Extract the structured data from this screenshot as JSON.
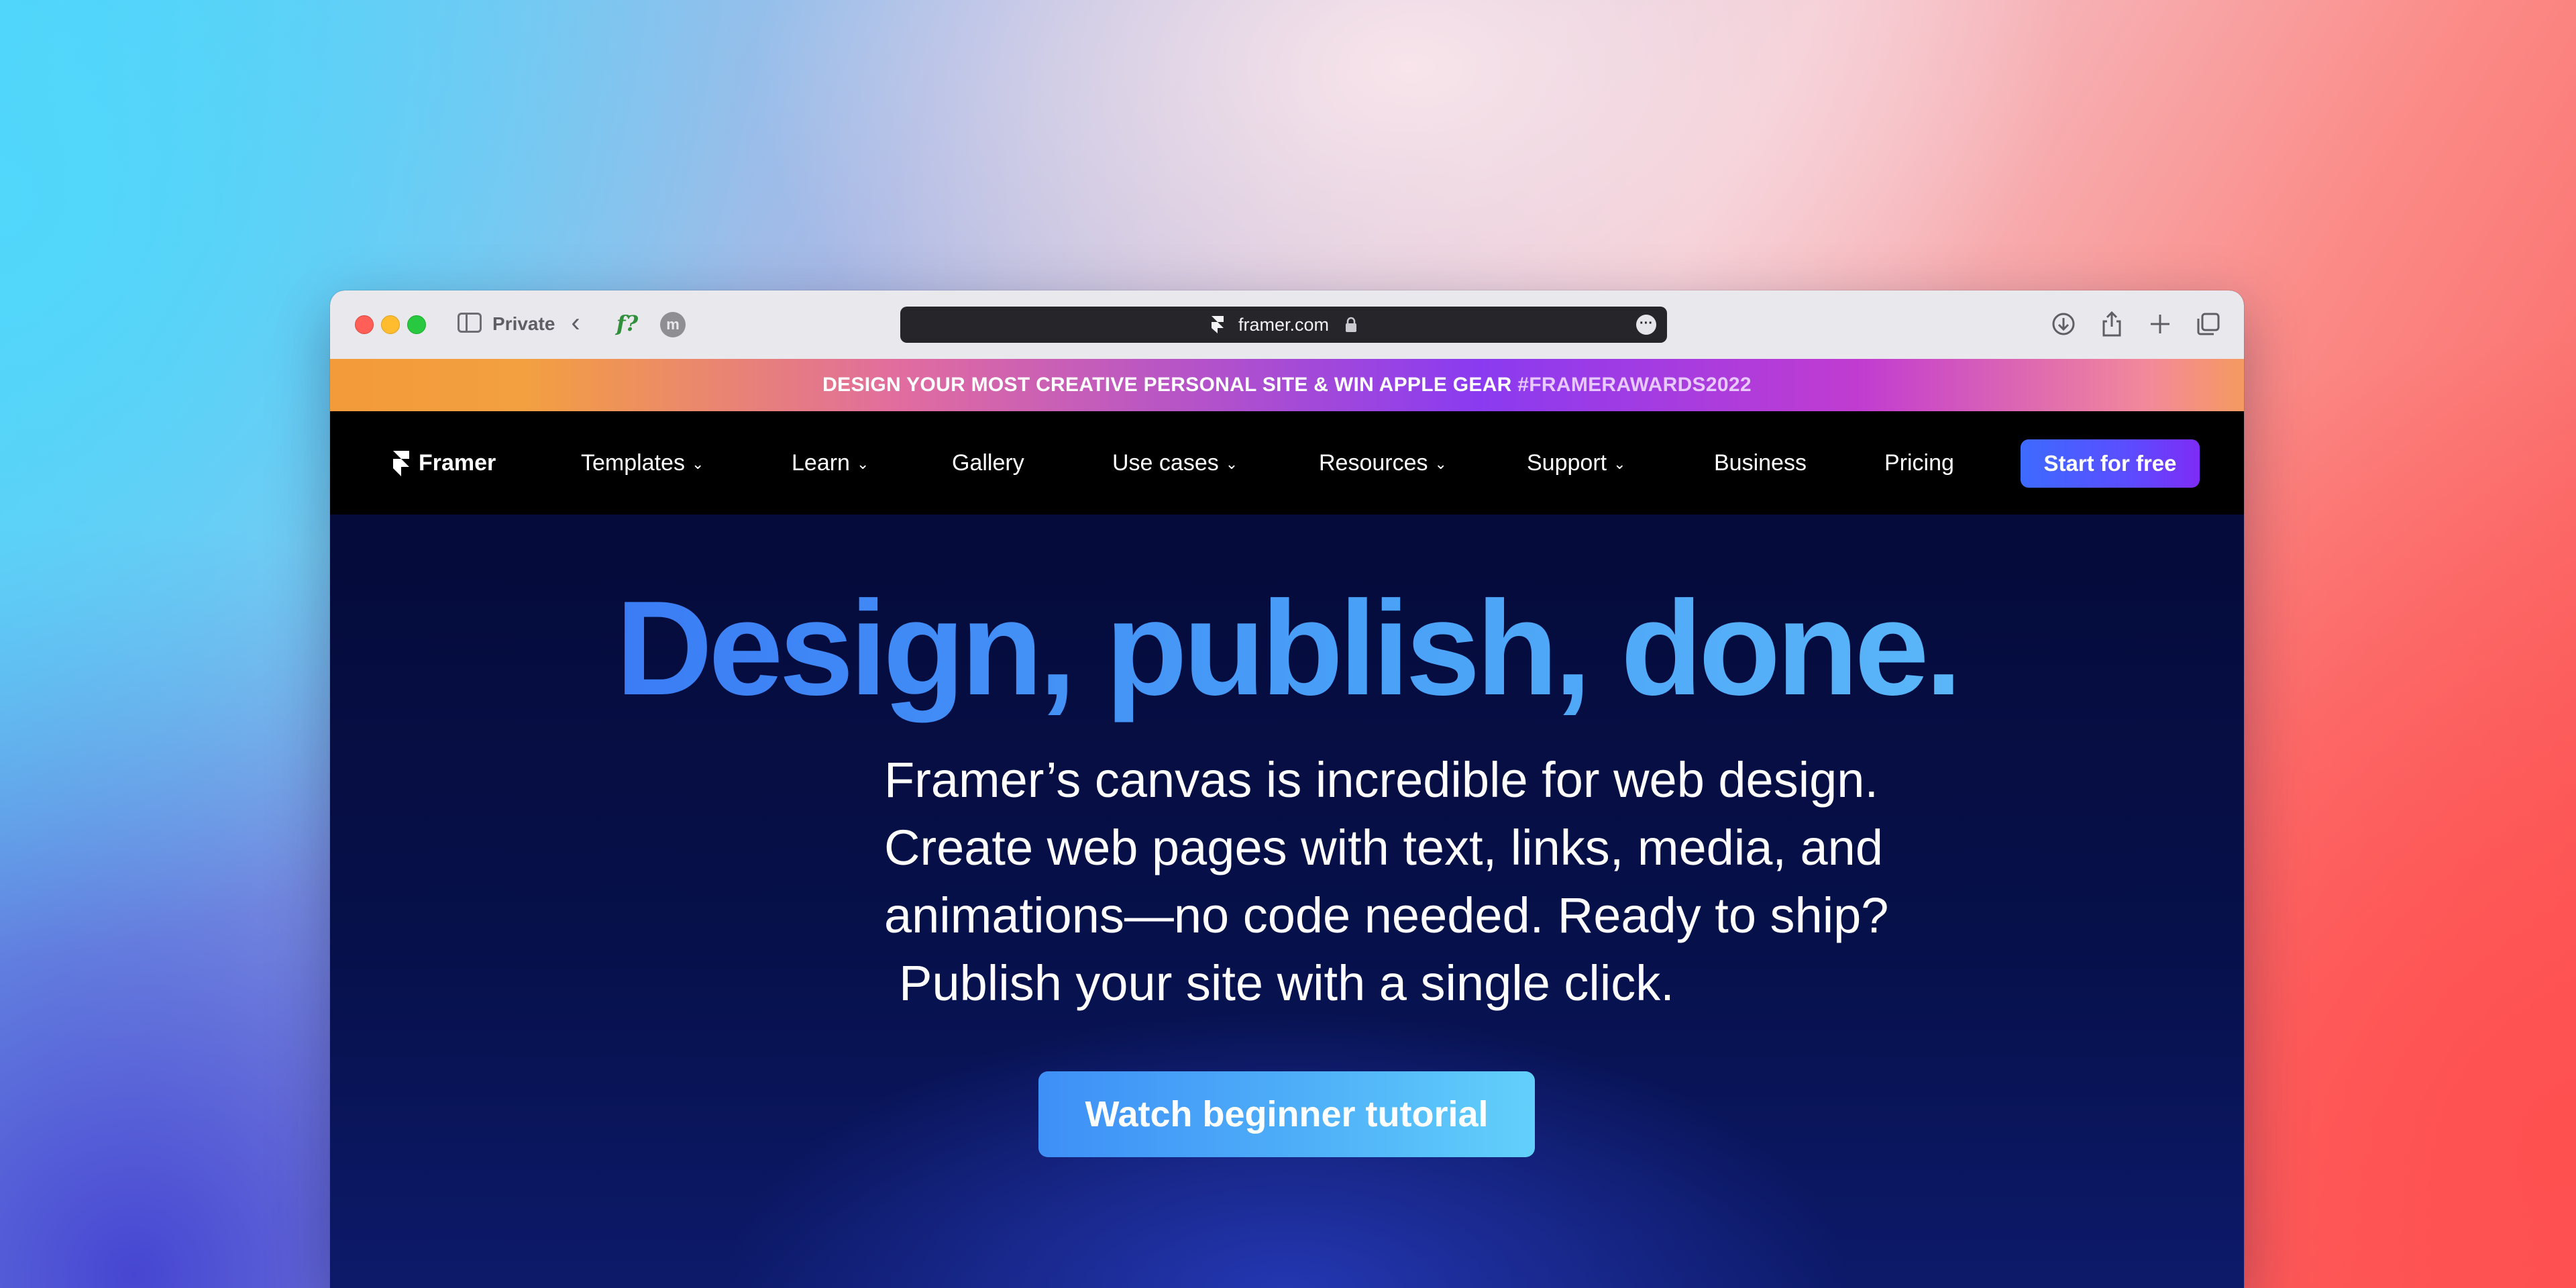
{
  "browser": {
    "private_label": "Private",
    "url": "framer.com",
    "extension_1": "f?",
    "extension_2": "m",
    "icons": [
      "sidebar-icon",
      "back-icon",
      "lock-icon",
      "more-icon",
      "download-icon",
      "share-icon",
      "new-tab-icon",
      "tabs-overview-icon"
    ]
  },
  "promo": {
    "text": "DESIGN YOUR MOST CREATIVE PERSONAL SITE & WIN APPLE GEAR",
    "hashtag": "#FRAMERAWARDS2022"
  },
  "nav": {
    "brand": "Framer",
    "items": [
      {
        "label": "Templates",
        "dropdown": true
      },
      {
        "label": "Learn",
        "dropdown": true
      },
      {
        "label": "Gallery",
        "dropdown": false
      },
      {
        "label": "Use cases",
        "dropdown": true
      },
      {
        "label": "Resources",
        "dropdown": true
      },
      {
        "label": "Support",
        "dropdown": true
      },
      {
        "label": "Business",
        "dropdown": false
      },
      {
        "label": "Pricing",
        "dropdown": false
      }
    ],
    "cta": "Start for free"
  },
  "hero": {
    "headline": "Design, publish, done.",
    "subtext_lines": [
      "Framer’s canvas is incredible for web design.",
      "Create web pages with text, links, media, and",
      "animations—no code needed. Ready to ship?",
      "Publish your site with a single click."
    ],
    "button": "Watch beginner tutorial"
  },
  "colors": {
    "accent_blue": "#3b7cf5",
    "cta_purple": "#7e2cf5",
    "hero_bg": "#06104a"
  }
}
